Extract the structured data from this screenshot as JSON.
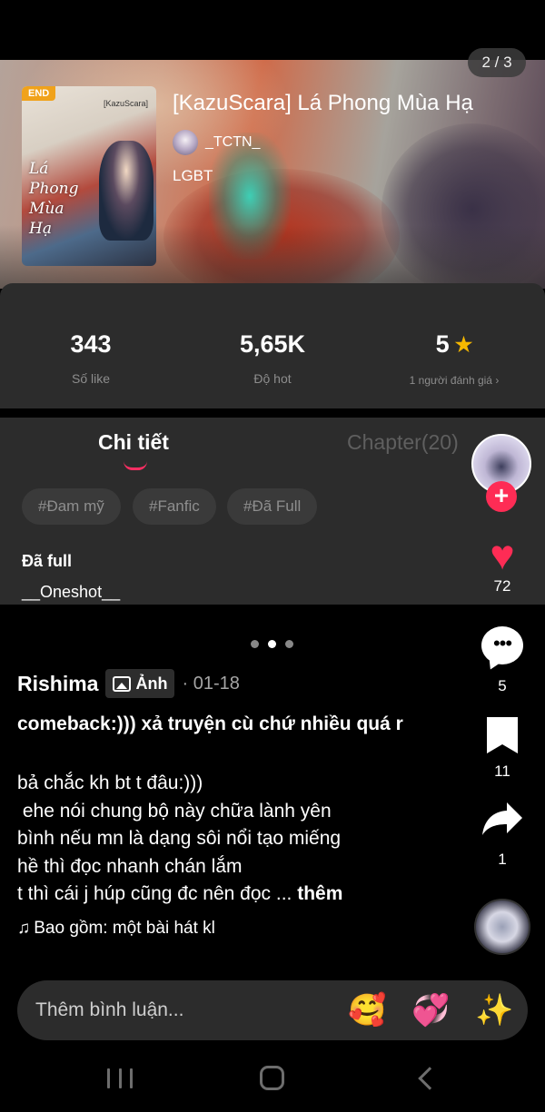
{
  "pager": {
    "indicator": "2 / 3"
  },
  "story": {
    "cover": {
      "badge": "END",
      "brand": "[KazuScara]",
      "title_art": "Lá\nPhong\nMùa\nHạ"
    },
    "title": "[KazuScara] Lá Phong Mùa Hạ",
    "author": "_TCTN_",
    "genre": "LGBT"
  },
  "stats": {
    "likes": {
      "value": "343",
      "label": "Số like"
    },
    "hot": {
      "value": "5,65K",
      "label": "Độ hot"
    },
    "rating": {
      "value": "5",
      "label": "1 người đánh giá",
      "chevron": "›",
      "icon": "star-icon"
    }
  },
  "tabs": {
    "details": "Chi tiết",
    "chapters": "Chapter(20)"
  },
  "tags": [
    "#Đam mỹ",
    "#Fanfic",
    "#Đã Full"
  ],
  "description": {
    "line1": "Đã full",
    "line2": "__Oneshot__"
  },
  "post": {
    "username": "Rishima",
    "media_label": "Ảnh",
    "date": "· 01-18",
    "title": "comeback:))) xả truyện cù chứ nhiều quá r",
    "body": "bả chắc kh bt t đâu:)))\n ehe nói chung bộ này chữa lành yên\nbình nếu mn là dạng sôi nổi tạo miếng\nhề thì đọc nhanh chán lắm\nt thì cái j húp cũng đc nên đọc ... ",
    "more": "thêm",
    "song_icon": "♫",
    "song": "Bao gồm: một bài hát kl"
  },
  "actions": {
    "follow": "+",
    "likes": "72",
    "comments": "5",
    "saves": "11",
    "shares": "1"
  },
  "comment_bar": {
    "placeholder": "Thêm bình luận...",
    "emojis": [
      "🥰",
      "💞",
      "✨"
    ]
  },
  "colors": {
    "accent": "#fe2c55",
    "panel": "#2c2c2c",
    "star": "#f5b800",
    "end_badge": "#f0a21b"
  }
}
